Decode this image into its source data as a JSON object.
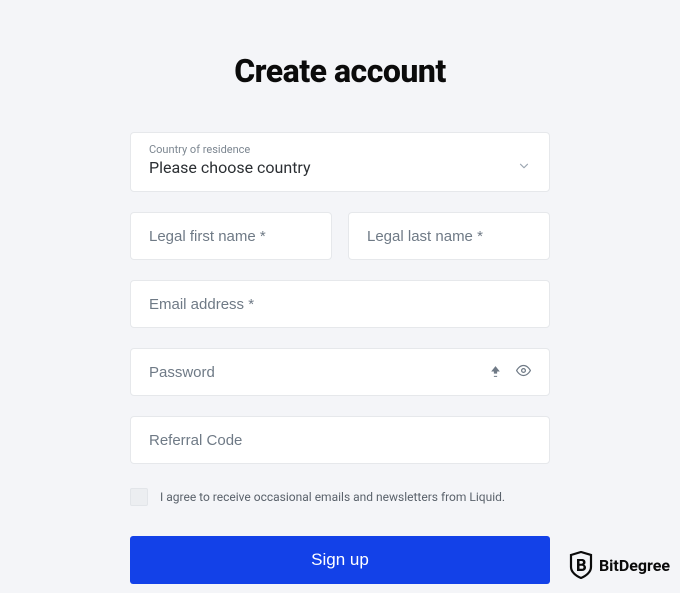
{
  "title": "Create account",
  "country": {
    "label": "Country of residence",
    "placeholder": "Please choose country"
  },
  "first_name": {
    "placeholder": "Legal first name *"
  },
  "last_name": {
    "placeholder": "Legal last name *"
  },
  "email": {
    "placeholder": "Email address *"
  },
  "password": {
    "placeholder": "Password"
  },
  "referral": {
    "placeholder": "Referral Code"
  },
  "newsletter": {
    "label": "I agree to receive occasional emails and newsletters from Liquid."
  },
  "signup": {
    "label": "Sign up"
  },
  "watermark": {
    "text": "BitDegree"
  }
}
